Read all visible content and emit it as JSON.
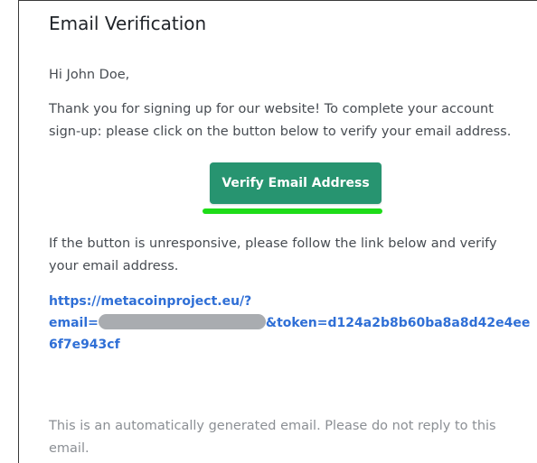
{
  "email": {
    "title": "Email Verification",
    "greeting": "Hi John Doe,",
    "intro": "Thank you for signing up for our website! To complete your account sign-up: please click on the button below to verify your email address.",
    "button_label": "Verify Email Address",
    "fallback": "If the button is unresponsive, please follow the link below and verify your email address.",
    "link": {
      "line1": "https://metacoinproject.eu/?",
      "prefix": "email=",
      "suffix": "&token=d124a2b8b60ba8a8d42e4ee",
      "line3": "6f7e943cf"
    },
    "footer": "This is an automatically generated email. Please do not reply to this email."
  },
  "colors": {
    "button": "#279470",
    "highlight": "#1edc18",
    "link": "#2f6fd6",
    "redaction": "#a9acb0"
  }
}
